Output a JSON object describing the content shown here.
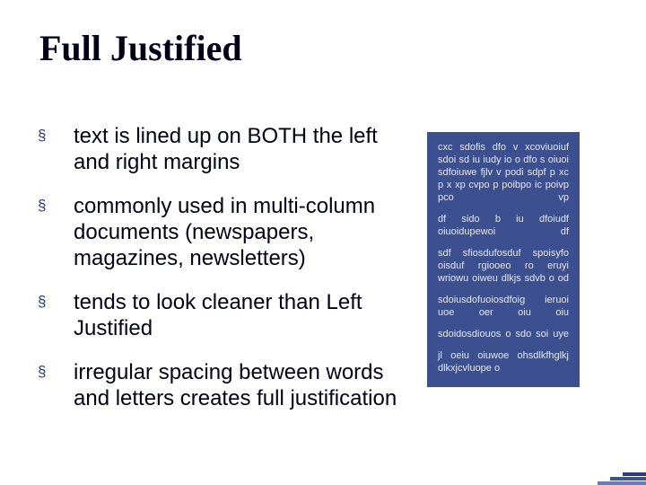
{
  "title": "Full Justified",
  "bullet_marker": "§",
  "bullets": [
    {
      "text": "text is lined up on BOTH the left and right margins"
    },
    {
      "text": "commonly used in multi-column documents (newspapers, magazines, newsletters)"
    },
    {
      "text": "tends to look cleaner than Left Justified"
    },
    {
      "text": "irregular spacing between words and letters creates full justification"
    }
  ],
  "example_paragraphs": [
    "cxc sdofis dfo v xcoviuoiuf sdoi sd iu iudy io o dfo s oiuoi sdfoiuwe fjlv v podi sdpf p xc p x xp cvpo p poibpo ic poivp pco vp",
    "df sido b iu dfoiudf oiuoidupewoi df",
    "sdf sfiosdufosduf spoisyfo oisduf rgiooeo ro eruyi wriowu oiweu dlkjs sdvb o od",
    "sdoiusdofuoiosdfoig ieruoi uoe oer oiu oiu",
    "sdoidosdiouos o sdo soi uye",
    "jl oeiu oiuwoe ohsdlkfhglkj dlkxjcvluope o"
  ]
}
